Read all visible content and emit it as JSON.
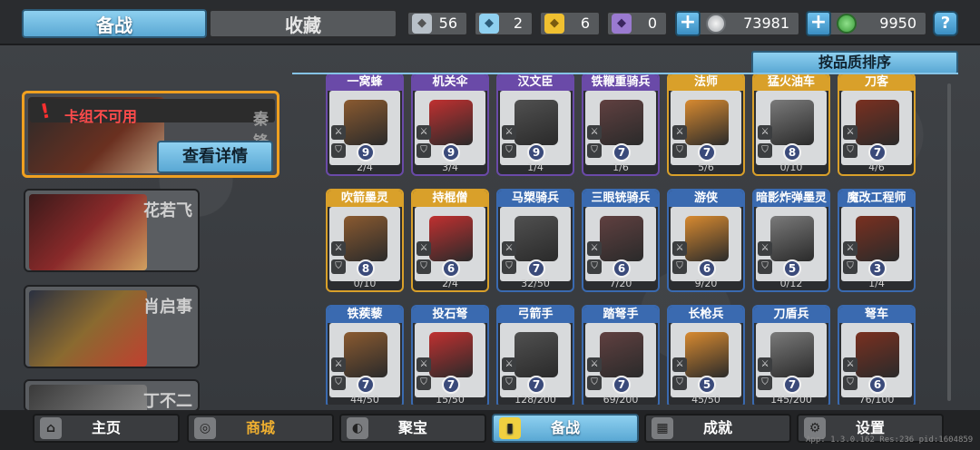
{
  "tabs": {
    "active": "备战",
    "inactive": "收藏"
  },
  "resources": [
    {
      "icon": "silver-crest-icon",
      "value": "56",
      "color": "#b8c0c8"
    },
    {
      "icon": "crystal-crest-icon",
      "value": "2",
      "color": "#8fd0f0"
    },
    {
      "icon": "gold-crest-icon",
      "value": "6",
      "color": "#f0c030"
    },
    {
      "icon": "purple-crest-icon",
      "value": "0",
      "color": "#9a7ad0"
    }
  ],
  "currency": {
    "silver_coins": "73981",
    "jade": "9950"
  },
  "help_label": "?",
  "sort_label": "按品质排序",
  "selected_hero": {
    "name": "秦锋",
    "warning": "卡组不可用",
    "detail_button": "查看详情"
  },
  "heroes": [
    {
      "name": "花若飞"
    },
    {
      "name": "肖启事"
    },
    {
      "name": "丁不二"
    }
  ],
  "units": [
    {
      "name": "一窝蜂",
      "cost": "9",
      "count": "2/4",
      "tier": "purple"
    },
    {
      "name": "机关伞",
      "cost": "9",
      "count": "3/4",
      "tier": "purple"
    },
    {
      "name": "汉文臣",
      "cost": "9",
      "count": "1/4",
      "tier": "purple"
    },
    {
      "name": "铁鞭重骑兵",
      "cost": "7",
      "count": "1/6",
      "tier": "purple"
    },
    {
      "name": "法师",
      "cost": "7",
      "count": "5/6",
      "tier": "gold"
    },
    {
      "name": "猛火油车",
      "cost": "8",
      "count": "0/10",
      "tier": "gold"
    },
    {
      "name": "刀客",
      "cost": "7",
      "count": "4/6",
      "tier": "gold"
    },
    {
      "name": "吹箭墨灵",
      "cost": "8",
      "count": "0/10",
      "tier": "gold"
    },
    {
      "name": "持棍僧",
      "cost": "6",
      "count": "2/4",
      "tier": "gold"
    },
    {
      "name": "马槊骑兵",
      "cost": "7",
      "count": "32/50",
      "tier": "blue"
    },
    {
      "name": "三眼铳骑兵",
      "cost": "6",
      "count": "7/20",
      "tier": "blue"
    },
    {
      "name": "游侠",
      "cost": "6",
      "count": "9/20",
      "tier": "blue"
    },
    {
      "name": "暗影炸弹墨灵",
      "cost": "5",
      "count": "0/12",
      "tier": "blue"
    },
    {
      "name": "魔改工程师",
      "cost": "3",
      "count": "1/4",
      "tier": "blue"
    },
    {
      "name": "铁蒺藜",
      "cost": "7",
      "count": "44/50",
      "tier": "blue"
    },
    {
      "name": "投石弩",
      "cost": "7",
      "count": "15/50",
      "tier": "blue"
    },
    {
      "name": "弓箭手",
      "cost": "7",
      "count": "128/200",
      "tier": "blue"
    },
    {
      "name": "踏弩手",
      "cost": "7",
      "count": "69/200",
      "tier": "blue"
    },
    {
      "name": "长枪兵",
      "cost": "5",
      "count": "45/50",
      "tier": "blue"
    },
    {
      "name": "刀盾兵",
      "cost": "7",
      "count": "145/200",
      "tier": "blue"
    },
    {
      "name": "弩车",
      "cost": "6",
      "count": "76/100",
      "tier": "blue"
    }
  ],
  "nav": [
    {
      "label": "主页",
      "icon": "home-icon"
    },
    {
      "label": "商城",
      "icon": "shop-coins-icon"
    },
    {
      "label": "聚宝",
      "icon": "treasure-icon"
    },
    {
      "label": "备战",
      "icon": "cards-icon"
    },
    {
      "label": "成就",
      "icon": "achievement-icon"
    },
    {
      "label": "设置",
      "icon": "gear-icon"
    }
  ],
  "version_text": "App: 1.3.0.162 Res:236 pid:1604859",
  "colors": {
    "accent": "#6fc0ec",
    "selected_border": "#f0a020",
    "warning": "#ff4b4b",
    "purple_tier": "#6a4aa8",
    "gold_tier": "#d9a02a",
    "blue_tier": "#3a6ab0"
  }
}
